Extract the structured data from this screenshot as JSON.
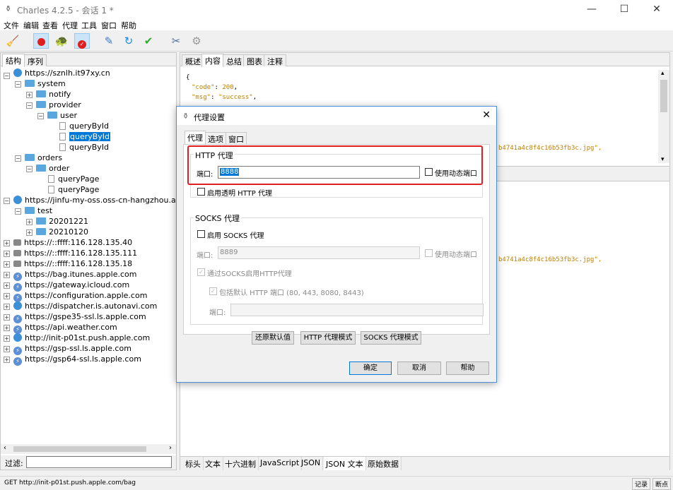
{
  "window": {
    "title": "Charles 4.2.5 - 会话 1 *",
    "minimize": "—",
    "maximize": "☐",
    "close": "✕"
  },
  "menu": [
    "文件",
    "编辑",
    "查看",
    "代理",
    "工具",
    "窗口",
    "帮助"
  ],
  "left": {
    "tabs": [
      "结构",
      "序列"
    ],
    "tree": [
      {
        "label": "https://sznlh.it97xy.cn"
      },
      {
        "label": "system"
      },
      {
        "label": "notify"
      },
      {
        "label": "provider"
      },
      {
        "label": "user"
      },
      {
        "label": "queryById"
      },
      {
        "label": "queryById"
      },
      {
        "label": "queryById"
      },
      {
        "label": "orders"
      },
      {
        "label": "order"
      },
      {
        "label": "queryPage"
      },
      {
        "label": "queryPage"
      },
      {
        "label": "https://jinfu-my-oss.oss-cn-hangzhou.aliyuncs"
      },
      {
        "label": "test"
      },
      {
        "label": "20201221"
      },
      {
        "label": "20210120"
      },
      {
        "label": "https://::ffff:116.128.135.40"
      },
      {
        "label": "https://::ffff:116.128.135.111"
      },
      {
        "label": "https://::ffff:116.128.135.18"
      },
      {
        "label": "https://bag.itunes.apple.com"
      },
      {
        "label": "https://gateway.icloud.com"
      },
      {
        "label": "https://configuration.apple.com"
      },
      {
        "label": "https://dispatcher.is.autonavi.com"
      },
      {
        "label": "https://gspe35-ssl.ls.apple.com"
      },
      {
        "label": "https://api.weather.com"
      },
      {
        "label": "http://init-p01st.push.apple.com"
      },
      {
        "label": "https://gsp-ssl.ls.apple.com"
      },
      {
        "label": "https://gsp64-ssl.ls.apple.com"
      }
    ],
    "filter_label": "过滤:"
  },
  "right": {
    "tabs": [
      "概述",
      "内容",
      "总结",
      "图表",
      "注释"
    ],
    "code": {
      "brace": "{",
      "code_key": "\"code\"",
      "code_val": "200",
      "msg_key": "\"msg\"",
      "msg_val": "\"success\"",
      "tail1": "b4741a4c8f4c16b53fb3c.jpg\",",
      "tail2": "b4741a4c8f4c16b53fb3c.jpg\","
    },
    "bottom_tabs": [
      "标头",
      "文本",
      "十六进制",
      "JavaScript",
      "JSON",
      "JSON 文本",
      "原始数据"
    ]
  },
  "status": {
    "text": "GET http://init-p01st.push.apple.com/bag",
    "record": "记录",
    "breakpoint": "断点"
  },
  "dialog": {
    "title": "代理设置",
    "close": "✕",
    "tabs": [
      "代理",
      "选项",
      "窗口"
    ],
    "http_group": "HTTP 代理",
    "port_label": "端口:",
    "http_port": "8888",
    "dynamic_port": "使用动态端口",
    "transparent": "启用透明 HTTP 代理",
    "socks_group": "SOCKS 代理",
    "enable_socks": "启用 SOCKS 代理",
    "socks_port_label": "端口:",
    "socks_port": "8889",
    "socks_dynamic_port": "使用动态端口",
    "http_over_socks": "通过SOCKS启用HTTP代理",
    "include_default": "包括默认 HTTP 端口 (80, 443, 8080, 8443)",
    "ports_label": "端口:",
    "btn_restore": "还原默认值",
    "btn_http_mode": "HTTP 代理模式",
    "btn_socks_mode": "SOCKS 代理模式",
    "btn_ok": "确定",
    "btn_cancel": "取消",
    "btn_help": "帮助"
  }
}
